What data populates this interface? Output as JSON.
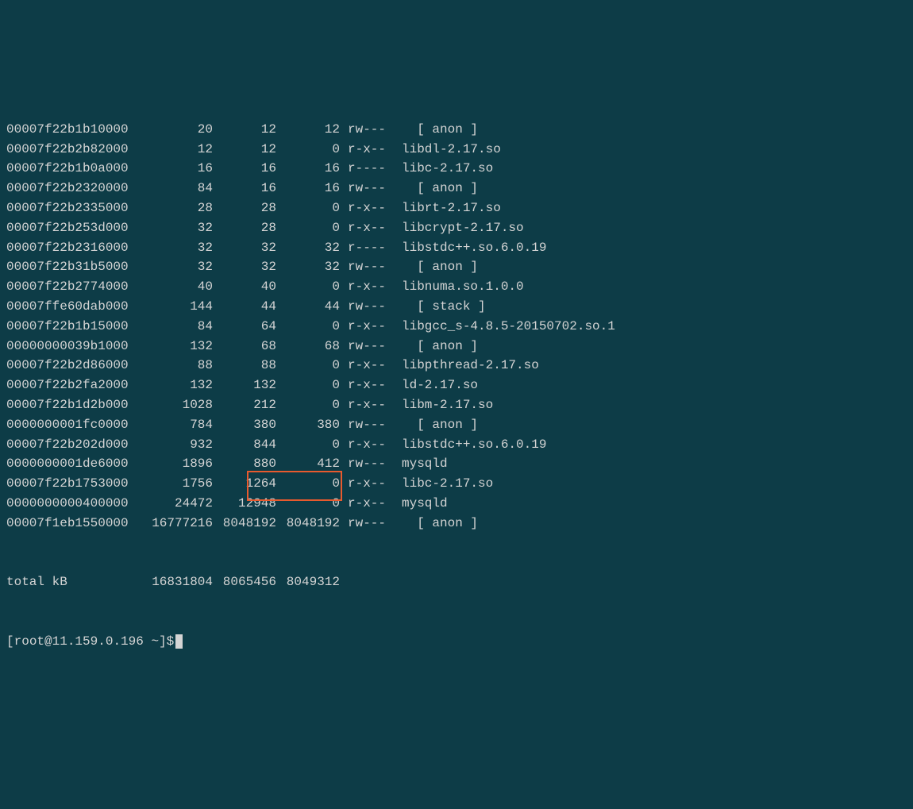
{
  "rows": [
    {
      "addr": "00007f22b1b10000",
      "kbytes": "20",
      "rss": "12",
      "dirty": "12",
      "mode": "rw---",
      "mapping": "  [ anon ]"
    },
    {
      "addr": "00007f22b2b82000",
      "kbytes": "12",
      "rss": "12",
      "dirty": "0",
      "mode": "r-x--",
      "mapping": "libdl-2.17.so"
    },
    {
      "addr": "00007f22b1b0a000",
      "kbytes": "16",
      "rss": "16",
      "dirty": "16",
      "mode": "r----",
      "mapping": "libc-2.17.so"
    },
    {
      "addr": "00007f22b2320000",
      "kbytes": "84",
      "rss": "16",
      "dirty": "16",
      "mode": "rw---",
      "mapping": "  [ anon ]"
    },
    {
      "addr": "00007f22b2335000",
      "kbytes": "28",
      "rss": "28",
      "dirty": "0",
      "mode": "r-x--",
      "mapping": "librt-2.17.so"
    },
    {
      "addr": "00007f22b253d000",
      "kbytes": "32",
      "rss": "28",
      "dirty": "0",
      "mode": "r-x--",
      "mapping": "libcrypt-2.17.so"
    },
    {
      "addr": "00007f22b2316000",
      "kbytes": "32",
      "rss": "32",
      "dirty": "32",
      "mode": "r----",
      "mapping": "libstdc++.so.6.0.19"
    },
    {
      "addr": "00007f22b31b5000",
      "kbytes": "32",
      "rss": "32",
      "dirty": "32",
      "mode": "rw---",
      "mapping": "  [ anon ]"
    },
    {
      "addr": "00007f22b2774000",
      "kbytes": "40",
      "rss": "40",
      "dirty": "0",
      "mode": "r-x--",
      "mapping": "libnuma.so.1.0.0"
    },
    {
      "addr": "00007ffe60dab000",
      "kbytes": "144",
      "rss": "44",
      "dirty": "44",
      "mode": "rw---",
      "mapping": "  [ stack ]"
    },
    {
      "addr": "00007f22b1b15000",
      "kbytes": "84",
      "rss": "64",
      "dirty": "0",
      "mode": "r-x--",
      "mapping": "libgcc_s-4.8.5-20150702.so.1"
    },
    {
      "addr": "00000000039b1000",
      "kbytes": "132",
      "rss": "68",
      "dirty": "68",
      "mode": "rw---",
      "mapping": "  [ anon ]"
    },
    {
      "addr": "00007f22b2d86000",
      "kbytes": "88",
      "rss": "88",
      "dirty": "0",
      "mode": "r-x--",
      "mapping": "libpthread-2.17.so"
    },
    {
      "addr": "00007f22b2fa2000",
      "kbytes": "132",
      "rss": "132",
      "dirty": "0",
      "mode": "r-x--",
      "mapping": "ld-2.17.so"
    },
    {
      "addr": "00007f22b1d2b000",
      "kbytes": "1028",
      "rss": "212",
      "dirty": "0",
      "mode": "r-x--",
      "mapping": "libm-2.17.so"
    },
    {
      "addr": "0000000001fc0000",
      "kbytes": "784",
      "rss": "380",
      "dirty": "380",
      "mode": "rw---",
      "mapping": "  [ anon ]"
    },
    {
      "addr": "00007f22b202d000",
      "kbytes": "932",
      "rss": "844",
      "dirty": "0",
      "mode": "r-x--",
      "mapping": "libstdc++.so.6.0.19"
    },
    {
      "addr": "0000000001de6000",
      "kbytes": "1896",
      "rss": "880",
      "dirty": "412",
      "mode": "rw---",
      "mapping": "mysqld"
    },
    {
      "addr": "00007f22b1753000",
      "kbytes": "1756",
      "rss": "1264",
      "dirty": "0",
      "mode": "r-x--",
      "mapping": "libc-2.17.so"
    },
    {
      "addr": "0000000000400000",
      "kbytes": "24472",
      "rss": "12948",
      "dirty": "0",
      "mode": "r-x--",
      "mapping": "mysqld"
    },
    {
      "addr": "00007f1eb1550000",
      "kbytes": "16777216",
      "rss": "8048192",
      "dirty": "8048192",
      "mode": "rw---",
      "mapping": "  [ anon ]"
    }
  ],
  "total": {
    "label": "total kB",
    "kbytes": "16831804",
    "rss": "8065456",
    "dirty": "8049312"
  },
  "prompt": {
    "user": "root",
    "host": "11.159.0.196",
    "path": "~",
    "symbol": "$"
  }
}
